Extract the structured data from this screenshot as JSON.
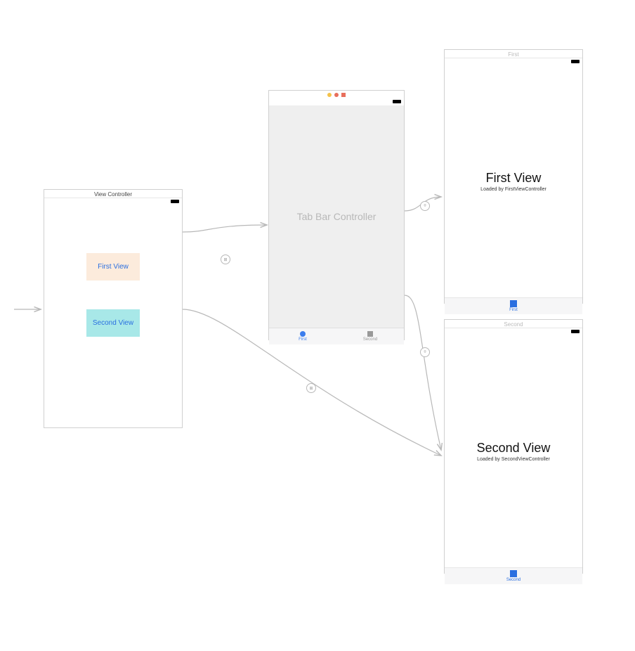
{
  "root": {
    "title": "View Controller",
    "button1": "First View",
    "button2": "Second View"
  },
  "tabbar_controller": {
    "body_label": "Tab Bar Controller",
    "tabs": [
      {
        "label": "First"
      },
      {
        "label": "Second"
      }
    ]
  },
  "first_scene": {
    "header": "First",
    "title": "First View",
    "subtitle": "Loaded by FirstViewController",
    "tab_label": "First"
  },
  "second_scene": {
    "header": "Second",
    "title": "Second View",
    "subtitle": "Loaded by SecondViewController",
    "tab_label": "Second"
  }
}
